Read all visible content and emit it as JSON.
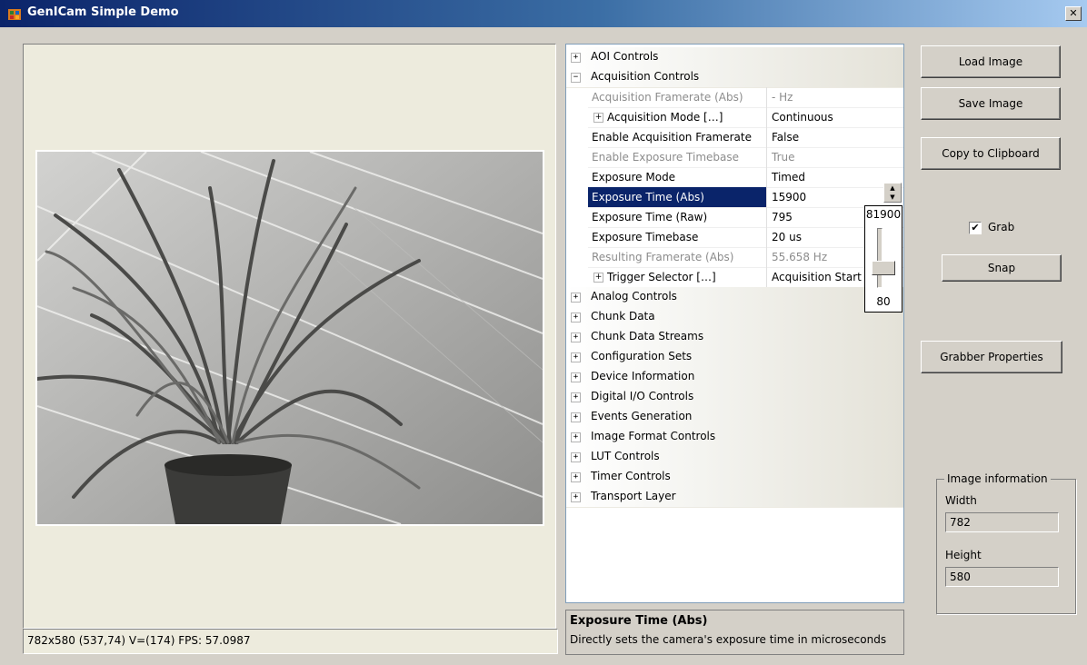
{
  "window": {
    "title": "GenICam Simple Demo",
    "close_label": "✕"
  },
  "viewer": {
    "status": "782x580  (537,74)  V=(174)  FPS: 57.0987"
  },
  "propgrid": {
    "rows": [
      {
        "kind": "category",
        "toggle": "+",
        "label": "AOI Controls"
      },
      {
        "kind": "category",
        "toggle": "−",
        "label": "Acquisition Controls"
      },
      {
        "kind": "prop",
        "name": "Acquisition Framerate (Abs)",
        "value": "- Hz",
        "disabled": true
      },
      {
        "kind": "prop",
        "name": "Acquisition Mode […]",
        "value": "Continuous",
        "expand": "+"
      },
      {
        "kind": "prop",
        "name": "Enable Acquisition Framerate",
        "value": "False"
      },
      {
        "kind": "prop",
        "name": "Enable Exposure Timebase",
        "value": "True",
        "disabled": true
      },
      {
        "kind": "prop",
        "name": "Exposure Mode",
        "value": "Timed"
      },
      {
        "kind": "prop",
        "name": "Exposure Time (Abs)",
        "value": "15900",
        "selected": true
      },
      {
        "kind": "prop",
        "name": "Exposure Time (Raw)",
        "value": "795"
      },
      {
        "kind": "prop",
        "name": "Exposure Timebase",
        "value": "20 us"
      },
      {
        "kind": "prop",
        "name": "Resulting Framerate (Abs)",
        "value": "55.658 Hz",
        "disabled": true
      },
      {
        "kind": "prop",
        "name": "Trigger Selector […]",
        "value": "Acquisition Start",
        "expand": "+"
      },
      {
        "kind": "category",
        "toggle": "+",
        "label": "Analog Controls"
      },
      {
        "kind": "category",
        "toggle": "+",
        "label": "Chunk Data"
      },
      {
        "kind": "category",
        "toggle": "+",
        "label": "Chunk Data Streams"
      },
      {
        "kind": "category",
        "toggle": "+",
        "label": "Configuration Sets"
      },
      {
        "kind": "category",
        "toggle": "+",
        "label": "Device Information"
      },
      {
        "kind": "category",
        "toggle": "+",
        "label": "Digital I/O Controls"
      },
      {
        "kind": "category",
        "toggle": "+",
        "label": "Events Generation"
      },
      {
        "kind": "category",
        "toggle": "+",
        "label": "Image Format Controls"
      },
      {
        "kind": "category",
        "toggle": "+",
        "label": "LUT Controls"
      },
      {
        "kind": "category",
        "toggle": "+",
        "label": "Timer Controls"
      },
      {
        "kind": "category",
        "toggle": "+",
        "label": "Transport Layer"
      }
    ],
    "slider": {
      "max": "81900",
      "min": "80"
    }
  },
  "description": {
    "title": "Exposure Time (Abs)",
    "text": "Directly sets the camera's exposure time in microseconds"
  },
  "buttons": {
    "load": "Load Image",
    "save": "Save Image",
    "copy": "Copy to Clipboard",
    "snap": "Snap",
    "grabber": "Grabber Properties"
  },
  "grab": {
    "label": "Grab",
    "checked": true,
    "mark": "✔"
  },
  "image_info": {
    "legend": "Image information",
    "width_label": "Width",
    "width_value": "782",
    "height_label": "Height",
    "height_value": "580"
  }
}
